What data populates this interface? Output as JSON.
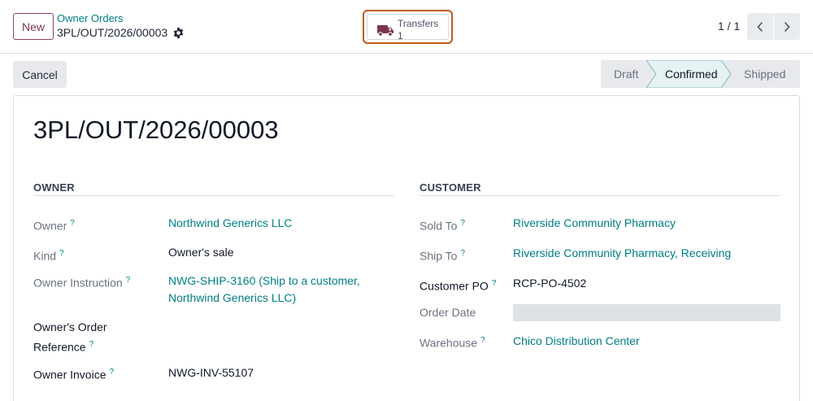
{
  "control_panel": {
    "new_label": "New",
    "breadcrumb": "Owner Orders",
    "record_name": "3PL/OUT/2026/00003",
    "smart_button": {
      "label": "Transfers",
      "count": "1",
      "icon": "truck-icon"
    },
    "pager": {
      "value": "1 / 1"
    }
  },
  "status_bar": {
    "cancel_label": "Cancel",
    "stages": [
      "Draft",
      "Confirmed",
      "Shipped"
    ],
    "current_stage": "Confirmed"
  },
  "form": {
    "title": "3PL/OUT/2026/00003",
    "owner_group": {
      "title": "OWNER",
      "fields": {
        "owner": {
          "label": "Owner",
          "help": "?",
          "value": "Northwind Generics LLC"
        },
        "kind": {
          "label": "Kind",
          "help": "?",
          "value": "Owner's sale"
        },
        "owner_instruction": {
          "label": "Owner Instruction",
          "help": "?",
          "value_line1": "NWG-SHIP-3160 (Ship to a customer,",
          "value_line2": "Northwind Generics LLC)"
        },
        "owners_order_reference": {
          "label_line1": "Owner's Order",
          "label_line2": "Reference",
          "help": "?",
          "value": ""
        },
        "owner_invoice": {
          "label": "Owner Invoice",
          "help": "?",
          "value": "NWG-INV-55107"
        }
      }
    },
    "customer_group": {
      "title": "CUSTOMER",
      "fields": {
        "sold_to": {
          "label": "Sold To",
          "help": "?",
          "value": "Riverside Community Pharmacy"
        },
        "ship_to": {
          "label": "Ship To",
          "help": "?",
          "value": "Riverside Community Pharmacy, Receiving"
        },
        "customer_po": {
          "label": "Customer PO",
          "help": "?",
          "value": "RCP-PO-4502"
        },
        "order_date": {
          "label": "Order Date",
          "value": ""
        },
        "warehouse": {
          "label": "Warehouse",
          "help": "?",
          "value": "Chico Distribution Center"
        }
      }
    }
  },
  "colors": {
    "brand": "#7b3553",
    "link": "#017e84",
    "highlight_border": "#c05a12",
    "active_stage_bg": "#e6f2f3",
    "inactive_stage_bg": "#e7e9ed"
  }
}
